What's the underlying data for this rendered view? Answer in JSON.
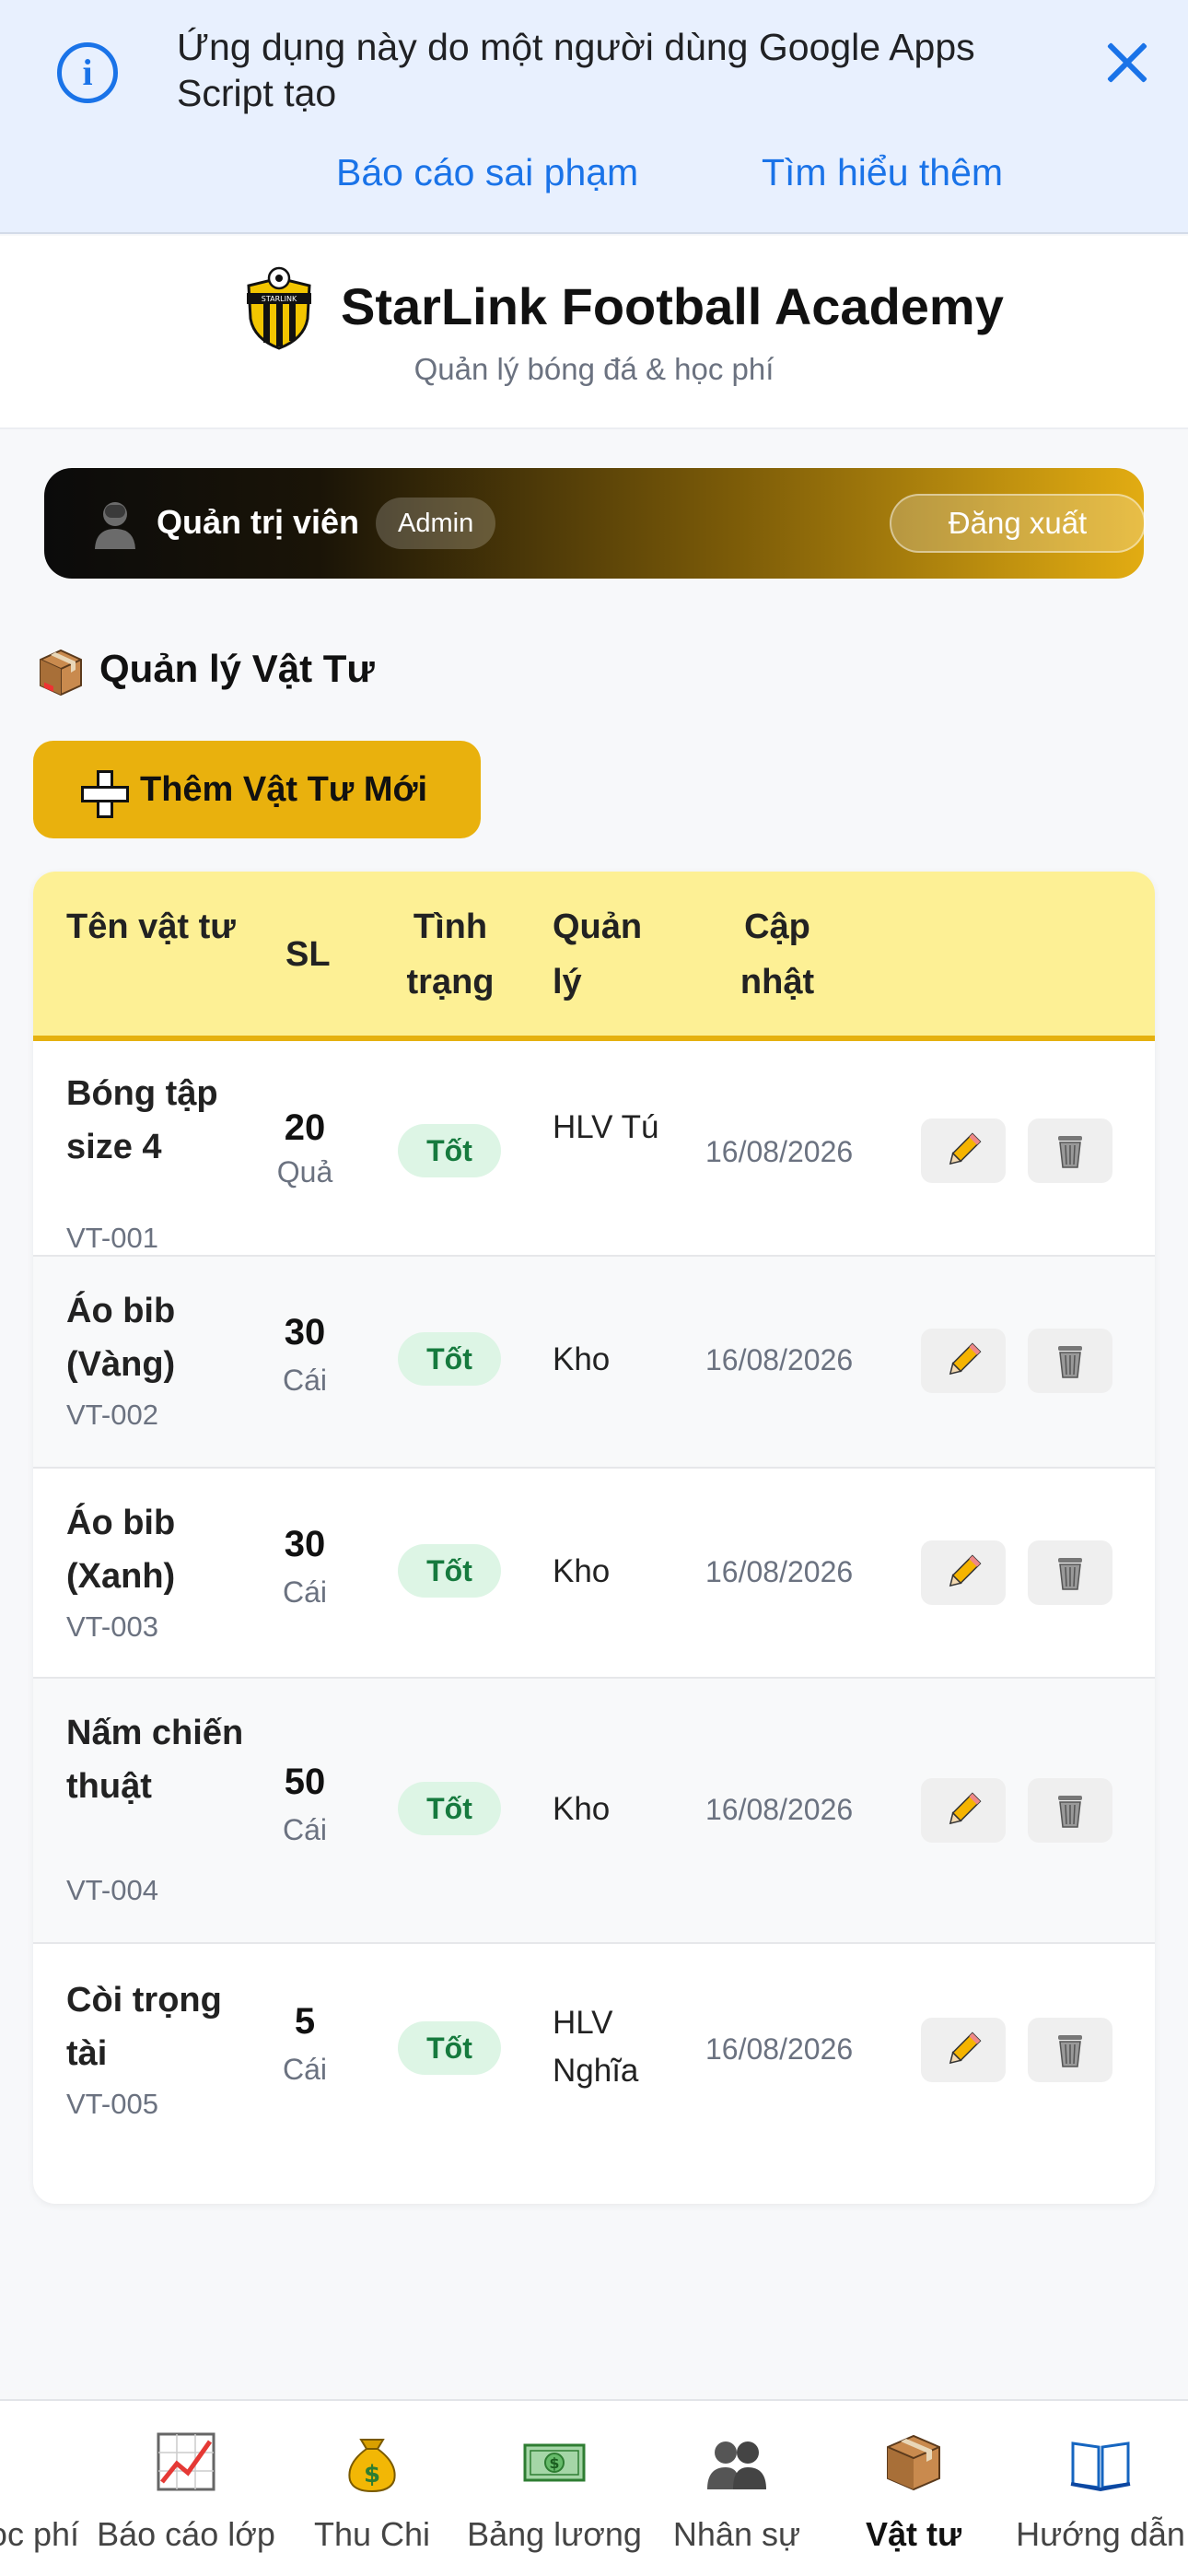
{
  "banner": {
    "message": "Ứng dụng này do một người dùng Google Apps Script tạo",
    "report_link": "Báo cáo sai phạm",
    "learn_link": "Tìm hiểu thêm"
  },
  "app": {
    "title": "StarLink Football Academy",
    "subtitle": "Quản lý bóng đá & học phí",
    "logo_text": "STARLINK"
  },
  "user": {
    "name": "Quản trị viên",
    "role": "Admin",
    "logout": "Đăng xuất"
  },
  "section": {
    "title": "Quản lý Vật Tư",
    "add_button": "Thêm Vật Tư Mới"
  },
  "table": {
    "headers": {
      "name": "Tên vật tư",
      "qty": "SL",
      "status": "Tình trạng",
      "manager": "Quản lý",
      "updated": "Cập nhật"
    },
    "rows": [
      {
        "name": "Bóng tập size 4",
        "code": "VT-001",
        "qty": "20",
        "unit": "Quả",
        "status": "Tốt",
        "manager": "HLV Tú",
        "updated": "16/08/2026"
      },
      {
        "name": "Áo bib (Vàng)",
        "code": "VT-002",
        "qty": "30",
        "unit": "Cái",
        "status": "Tốt",
        "manager": "Kho",
        "updated": "16/08/2026"
      },
      {
        "name": "Áo bib (Xanh)",
        "code": "VT-003",
        "qty": "30",
        "unit": "Cái",
        "status": "Tốt",
        "manager": "Kho",
        "updated": "16/08/2026"
      },
      {
        "name": "Nấm chiến thuật",
        "code": "VT-004",
        "qty": "50",
        "unit": "Cái",
        "status": "Tốt",
        "manager": "Kho",
        "updated": "16/08/2026"
      },
      {
        "name": "Còi trọng tài",
        "code": "VT-005",
        "qty": "5",
        "unit": "Cái",
        "status": "Tốt",
        "manager": "HLV Nghĩa",
        "updated": "16/08/2026"
      }
    ]
  },
  "nav": {
    "items": [
      {
        "label": "Học phí",
        "icon": "tuition-icon"
      },
      {
        "label": "Báo cáo lớp",
        "icon": "chart-icon"
      },
      {
        "label": "Thu Chi",
        "icon": "money-bag-icon"
      },
      {
        "label": "Bảng lương",
        "icon": "banknote-icon"
      },
      {
        "label": "Nhân sự",
        "icon": "people-icon"
      },
      {
        "label": "Vật tư",
        "icon": "package-icon"
      },
      {
        "label": "Hướng dẫn",
        "icon": "book-icon"
      }
    ],
    "active": "Vật tư"
  },
  "colors": {
    "accent": "#e9b10d",
    "link": "#1a73e8",
    "status_good_bg": "#ddf5e5",
    "status_good_text": "#167a3e",
    "table_header_bg": "#fdf095"
  }
}
